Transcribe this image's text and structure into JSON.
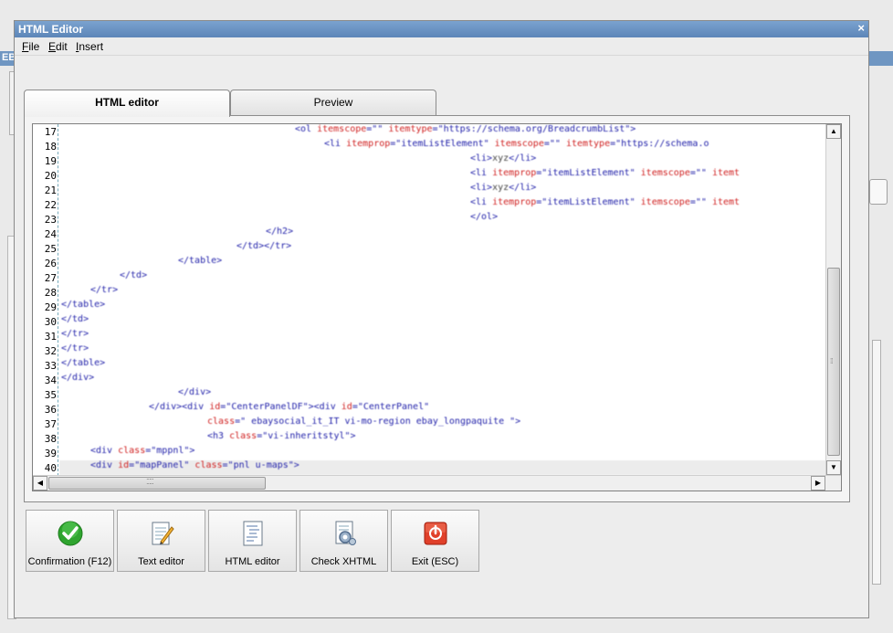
{
  "window": {
    "title": "HTML Editor",
    "close_glyph": "×"
  },
  "background_app": {
    "label": "EB"
  },
  "menu": [
    {
      "label": "File"
    },
    {
      "label": "Edit"
    },
    {
      "label": "Insert"
    }
  ],
  "tabs": [
    {
      "label": "HTML editor",
      "active": true
    },
    {
      "label": "Preview",
      "active": false
    }
  ],
  "editor": {
    "line_numbers": [
      "17",
      "18",
      "19",
      "20",
      "21",
      "22",
      "23",
      "24",
      "25",
      "26",
      "27",
      "28",
      "29",
      "30",
      "31",
      "32",
      "33",
      "34",
      "35",
      "36",
      "37",
      "38",
      "39",
      "40"
    ],
    "current_line": "40",
    "scroll_up_glyph": "▲",
    "scroll_down_glyph": "▼",
    "scroll_left_glyph": "◀",
    "scroll_right_glyph": "▶"
  },
  "buttons": [
    {
      "label": "Confirmation (F12)",
      "icon": "check-icon"
    },
    {
      "label": "Text editor",
      "icon": "text-edit-icon"
    },
    {
      "label": "HTML editor",
      "icon": "html-edit-icon"
    },
    {
      "label": "Check XHTML",
      "icon": "check-xhtml-icon"
    },
    {
      "label": "Exit (ESC)",
      "icon": "exit-icon"
    }
  ],
  "colors": {
    "title_bar": "#6b93c4",
    "tag": "#2222aa",
    "attribute": "#d02020",
    "gutter_border": "#77aabb",
    "exit_red": "#e0402a",
    "check_green": "#2fa42f"
  }
}
